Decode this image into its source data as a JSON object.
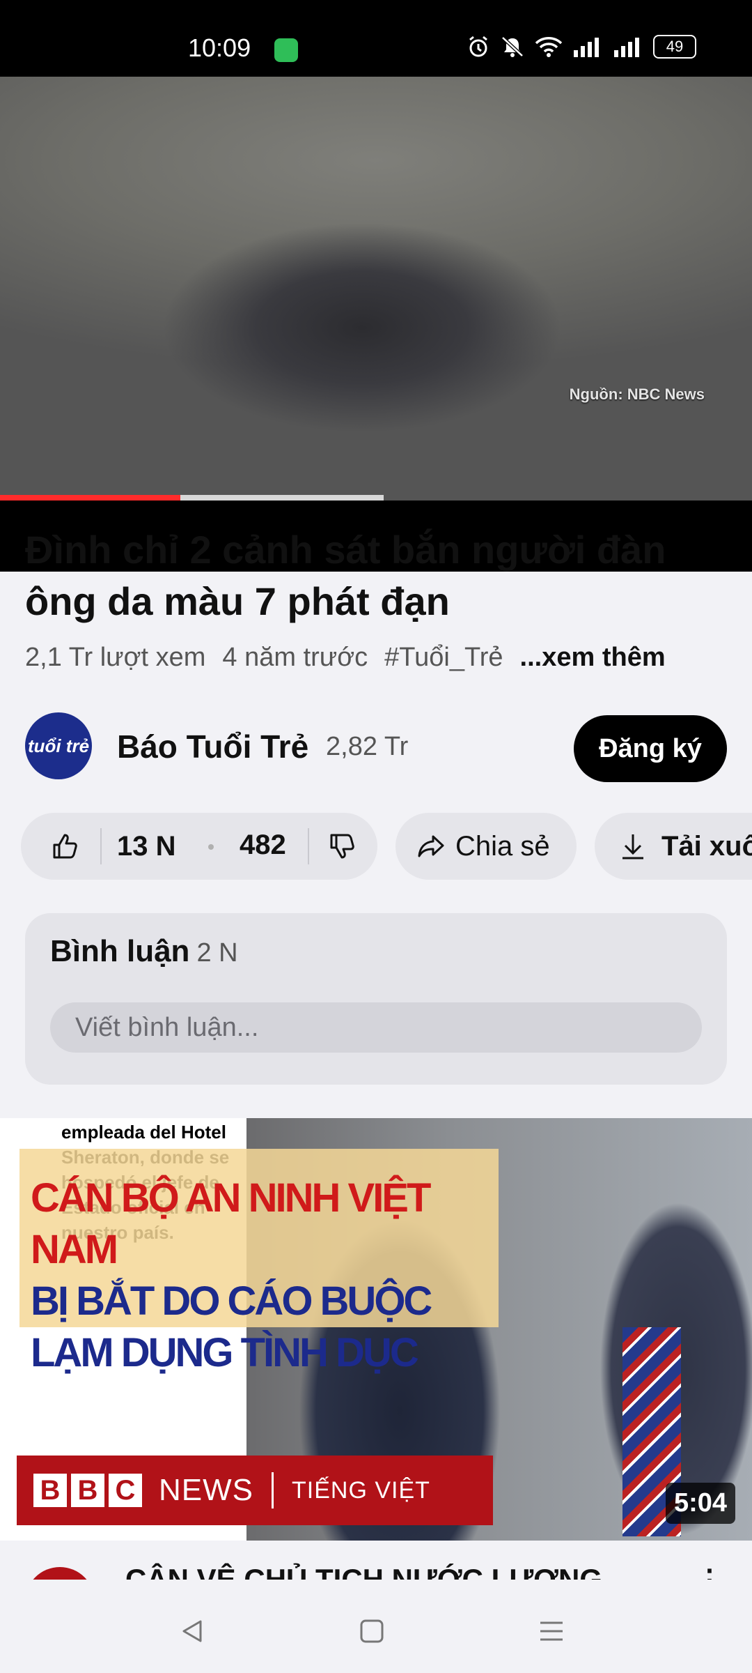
{
  "status_bar": {
    "time": "10:09",
    "battery": "49",
    "icons": [
      "message-icon",
      "alarm-icon",
      "mute-icon",
      "wifi-icon",
      "signal-icon",
      "signal-icon",
      "battery-icon"
    ]
  },
  "player": {
    "source_label": "Nguồn:  NBC News",
    "progress_played": 0.24,
    "progress_buffered_start": 0.24,
    "progress_buffered_end": 0.51
  },
  "video": {
    "title": "Đình chỉ 2 cảnh sát bắn người đàn ông da màu 7 phát đạn",
    "views": "2,1 Tr lượt xem",
    "age": "4 năm trước",
    "hashtag": "#Tuổi_Trẻ",
    "more_label": "...xem thêm"
  },
  "channel": {
    "logo_text": "tuổi trẻ",
    "name": "Báo Tuổi Trẻ",
    "subscribers": "2,82 Tr",
    "subscribe_label": "Đăng ký"
  },
  "actions": {
    "likes": "13 N",
    "dislikes": "482",
    "share_label": "Chia sẻ",
    "download_label": "Tải xuống"
  },
  "comments": {
    "title": "Bình luận",
    "count": "2 N",
    "input_placeholder": "Viết bình luận..."
  },
  "next_video": {
    "thumb_caption": "empleada del Hotel Sheraton, donde se hospedó el jefe de Estado oficial en nuestro país.",
    "headline_line1": "CÁN BỘ AN NINH VIỆT NAM",
    "headline_line2": "BỊ BẮT DO CÁO BUỘC",
    "headline_line3": "LẠM DỤNG TÌNH DỤC",
    "bbc_letters": [
      "B",
      "B",
      "C"
    ],
    "bbc_news": "NEWS",
    "bbc_lang": "TIẾNG VIỆT",
    "duration": "5:04",
    "title_partial": "CẬN VỆ CHỦ TỊCH NƯỚC LƯƠNG"
  },
  "navbar": {
    "items": [
      "back-icon",
      "home-icon",
      "recents-icon"
    ]
  }
}
